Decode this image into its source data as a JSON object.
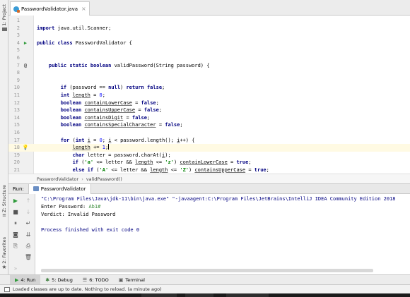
{
  "left_tool_strip": {
    "project_label": "1: Project",
    "structure_label": "Z: Structure",
    "favorites_label": "2: Favorites"
  },
  "editor_tab": {
    "filename": "PasswordValidator.java",
    "close_glyph": "×"
  },
  "editor": {
    "current_line": 18,
    "lines": [
      {
        "n": "1",
        "html": ""
      },
      {
        "n": "2",
        "html": "<span class=\"kw\">import</span> java.util.Scanner;"
      },
      {
        "n": "3",
        "html": ""
      },
      {
        "n": "4",
        "html": "<span class=\"kw\">public class</span> PasswordValidator {",
        "mark": "run"
      },
      {
        "n": "5",
        "html": ""
      },
      {
        "n": "6",
        "html": ""
      },
      {
        "n": "7",
        "html": "    <span class=\"kw\">public static boolean</span> validPassword(String password) {",
        "mark": "at"
      },
      {
        "n": "8",
        "html": ""
      },
      {
        "n": "9",
        "html": ""
      },
      {
        "n": "10",
        "html": "        <span class=\"kw\">if</span> (password == <span class=\"kw\">null</span>) <span class=\"kw\">return false</span>;"
      },
      {
        "n": "11",
        "html": "        <span class=\"kw\">int</span> <span class=\"u\">length</span> = <span class=\"num\">0</span>;"
      },
      {
        "n": "12",
        "html": "        <span class=\"kw\">boolean</span> <span class=\"u\">containLowerCase</span> = <span class=\"kw\">false</span>;"
      },
      {
        "n": "13",
        "html": "        <span class=\"kw\">boolean</span> <span class=\"u\">containsUpperCase</span> = <span class=\"kw\">false</span>;"
      },
      {
        "n": "14",
        "html": "        <span class=\"kw\">boolean</span> <span class=\"u\">containsDigit</span> = <span class=\"kw\">false</span>;"
      },
      {
        "n": "15",
        "html": "        <span class=\"kw\">boolean</span> <span class=\"u\">containsSpecialCharacter</span> = <span class=\"kw\">false</span>;"
      },
      {
        "n": "16",
        "html": ""
      },
      {
        "n": "17",
        "html": "        <span class=\"kw\">for</span> (<span class=\"kw\">int</span> <span class=\"u\">i</span> = <span class=\"num\">0</span>; <span class=\"u\">i</span> &lt; password.length(); <span class=\"u\">i</span>++) {"
      },
      {
        "n": "18",
        "html": "            <span class=\"u\">length</span> += <span class=\"num\">1</span>;<span class=\"caret\"></span>",
        "mark": "bulb"
      },
      {
        "n": "19",
        "html": "            <span class=\"kw\">char</span> letter = password.charAt(<span class=\"u\">i</span>);"
      },
      {
        "n": "20",
        "html": "            <span class=\"kw\">if</span> (<span class=\"str\">'a'</span> &lt;= letter &amp;&amp; <span class=\"u\">length</span> &lt;= <span class=\"str\">'z'</span>) <span class=\"u\">containLowerCase</span> = <span class=\"kw\">true</span>;"
      },
      {
        "n": "21",
        "html": "            <span class=\"kw\">else if</span> (<span class=\"str\">'A'</span> &lt;= letter &amp;&amp; <span class=\"u\">length</span> &lt;= <span class=\"str\">'Z'</span>) <span class=\"u\">containsUpperCase</span> = <span class=\"kw\">true</span>;"
      }
    ]
  },
  "breadcrumb": {
    "class_name": "PasswordValidator",
    "separator": "›",
    "method_name": "validPassword()"
  },
  "run_window": {
    "title": "Run:",
    "config_tab": "PasswordValidator",
    "console": {
      "command": "\"C:\\Program Files\\Java\\jdk-11\\bin\\java.exe\" \"-javaagent:C:\\Program Files\\JetBrains\\IntelliJ IDEA Community Edition 2018",
      "prompt": "Enter Password: ",
      "user_input": "Ab1#",
      "verdict": "Verdict: Invalid Password",
      "blank": "",
      "exit": "Process finished with exit code 0"
    }
  },
  "bottom_tools": {
    "run": "4: Run",
    "debug": "5: Debug",
    "todo": "6: TODO",
    "terminal": "Terminal"
  },
  "status_bar": {
    "message": "Loaded classes are up to date. Nothing to reload. (a minute ago)"
  },
  "colors": {
    "keyword": "#000080",
    "string_literal": "#008000",
    "number_literal": "#0000ff",
    "current_line_highlight": "#fffae3",
    "run_green": "#2e9a3a"
  }
}
